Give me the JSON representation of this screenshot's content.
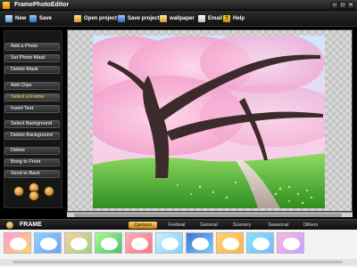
{
  "window": {
    "title": "FramePhotoEditor"
  },
  "toolbar": {
    "new": "New",
    "save": "Save",
    "open_project": "Open project",
    "save_project": "Save project",
    "wallpaper": "wallpaper",
    "email": "Email",
    "help": "Help"
  },
  "sidebar": {
    "items": [
      {
        "label": "Add a Photo"
      },
      {
        "label": "Set Photo Mask"
      },
      {
        "label": "Delete Mask"
      },
      {
        "label": "Add Clips"
      },
      {
        "label": "Select a Frame"
      },
      {
        "label": "Insert Text"
      },
      {
        "label": "Select Background"
      },
      {
        "label": "Delete Background"
      },
      {
        "label": "Delete"
      },
      {
        "label": "Bring to Front"
      },
      {
        "label": "Send to Back"
      }
    ],
    "active_item": "Select a Frame"
  },
  "frame_panel": {
    "title": "FRAME",
    "tabs": [
      {
        "label": "Cartoon"
      },
      {
        "label": "Festival"
      },
      {
        "label": "General"
      },
      {
        "label": "Scenery"
      },
      {
        "label": "Seasonal"
      },
      {
        "label": "Others"
      }
    ],
    "active_tab": "Cartoon"
  },
  "colors": {
    "accent": "#ffd23a",
    "sakura": "#f7b3d3",
    "grass": "#3e9b2a"
  }
}
